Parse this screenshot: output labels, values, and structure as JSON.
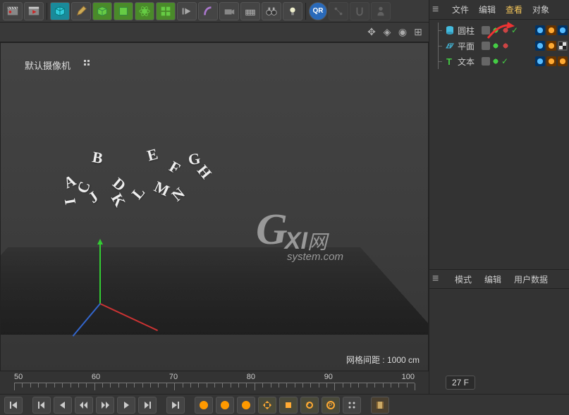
{
  "toolbar": {
    "qr_label": "QR"
  },
  "viewport": {
    "camera_label": "默认摄像机",
    "grid_spacing_label": "网格间距 : 1000 cm",
    "watermark_g": "G",
    "watermark_xi": "XI",
    "watermark_net": "网",
    "watermark_sub": "system.com"
  },
  "object_panel": {
    "tabs": {
      "file": "文件",
      "edit": "编辑",
      "view": "查看",
      "object": "对象"
    },
    "items": [
      {
        "name": "圆柱",
        "type": "cylinder"
      },
      {
        "name": "平面",
        "type": "plane"
      },
      {
        "name": "文本",
        "type": "text"
      }
    ]
  },
  "attr_panel": {
    "tabs": {
      "mode": "模式",
      "edit": "编辑",
      "userdata": "用户数据"
    }
  },
  "timeline": {
    "labels": [
      "50",
      "60",
      "70",
      "80",
      "90",
      "100"
    ],
    "current_frame": "27 F"
  }
}
